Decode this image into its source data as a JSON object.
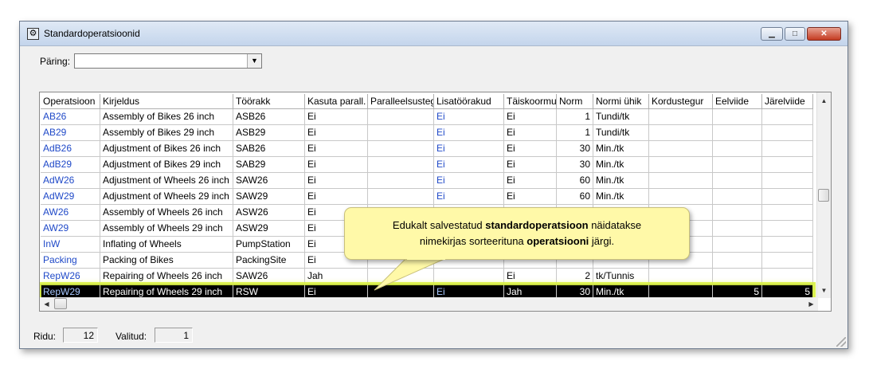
{
  "window": {
    "title": "Standardoperatsioonid"
  },
  "query": {
    "label": "Päring:",
    "value": ""
  },
  "grid": {
    "columns": [
      "Operatsioon",
      "Kirjeldus",
      "Töörakk",
      "Kasuta parall.",
      "Paralleelsusteg",
      "Lisatöörakud",
      "Täiskoormu",
      "Norm",
      "Normi ühik",
      "Kordustegur",
      "Eelviide",
      "Järelviide"
    ],
    "rows": [
      [
        "AB26",
        "Assembly of Bikes 26 inch",
        "ASB26",
        "Ei",
        "",
        "Ei",
        "Ei",
        "1",
        "Tundi/tk",
        "",
        "",
        ""
      ],
      [
        "AB29",
        "Assembly of Bikes 29 inch",
        "ASB29",
        "Ei",
        "",
        "Ei",
        "Ei",
        "1",
        "Tundi/tk",
        "",
        "",
        ""
      ],
      [
        "AdB26",
        "Adjustment of Bikes 26 inch",
        "SAB26",
        "Ei",
        "",
        "Ei",
        "Ei",
        "30",
        "Min./tk",
        "",
        "",
        ""
      ],
      [
        "AdB29",
        "Adjustment of Bikes 29 inch",
        "SAB29",
        "Ei",
        "",
        "Ei",
        "Ei",
        "30",
        "Min./tk",
        "",
        "",
        ""
      ],
      [
        "AdW26",
        "Adjustment of Wheels 26 inch",
        "SAW26",
        "Ei",
        "",
        "Ei",
        "Ei",
        "60",
        "Min./tk",
        "",
        "",
        ""
      ],
      [
        "AdW29",
        "Adjustment of Wheels 29 inch",
        "SAW29",
        "Ei",
        "",
        "Ei",
        "Ei",
        "60",
        "Min./tk",
        "",
        "",
        ""
      ],
      [
        "AW26",
        "Assembly of Wheels 26 inch",
        "ASW26",
        "Ei",
        "",
        "",
        "",
        "",
        "",
        "",
        "",
        ""
      ],
      [
        "AW29",
        "Assembly of Wheels 29 inch",
        "ASW29",
        "Ei",
        "",
        "",
        "",
        "",
        "",
        "",
        "",
        ""
      ],
      [
        "InW",
        "Inflating of Wheels",
        "PumpStation",
        "Ei",
        "",
        "",
        "",
        "",
        "",
        "",
        "",
        ""
      ],
      [
        "Packing",
        "Packing of Bikes",
        "PackingSite",
        "Ei",
        "",
        "",
        "",
        "",
        "",
        "",
        "",
        ""
      ],
      [
        "RepW26",
        "Repairing of Wheels 26 inch",
        "SAW26",
        "Jah",
        "",
        "",
        "Ei",
        "2",
        "tk/Tunnis",
        "",
        "",
        ""
      ],
      [
        "RepW29",
        "Repairing of Wheels 29 inch",
        "RSW",
        "Ei",
        "",
        "Ei",
        "Jah",
        "30",
        "Min./tk",
        "",
        "5",
        "5"
      ]
    ],
    "selected_row": 11
  },
  "status": {
    "rows_label": "Ridu:",
    "rows_value": "12",
    "selected_label": "Valitud:",
    "selected_value": "1"
  },
  "callout": {
    "text_1": "Edukalt salvestatud ",
    "bold_1": "standardoperatsioon",
    "text_2": " näidatakse",
    "text_3": "nimekirjas sorteerituna ",
    "bold_2": "operatsiooni",
    "text_4": " järgi."
  },
  "colors": {
    "link": "#1f49c8",
    "selection": "#000000",
    "highlight": "#d7f03c",
    "callout": "#fff9a8"
  },
  "icons": [
    "app-icon",
    "minimize-icon",
    "maximize-icon",
    "close-icon",
    "dropdown-arrow-icon",
    "scroll-up-icon",
    "scroll-down-icon",
    "scroll-left-icon",
    "scroll-right-icon",
    "resize-grip-icon"
  ]
}
